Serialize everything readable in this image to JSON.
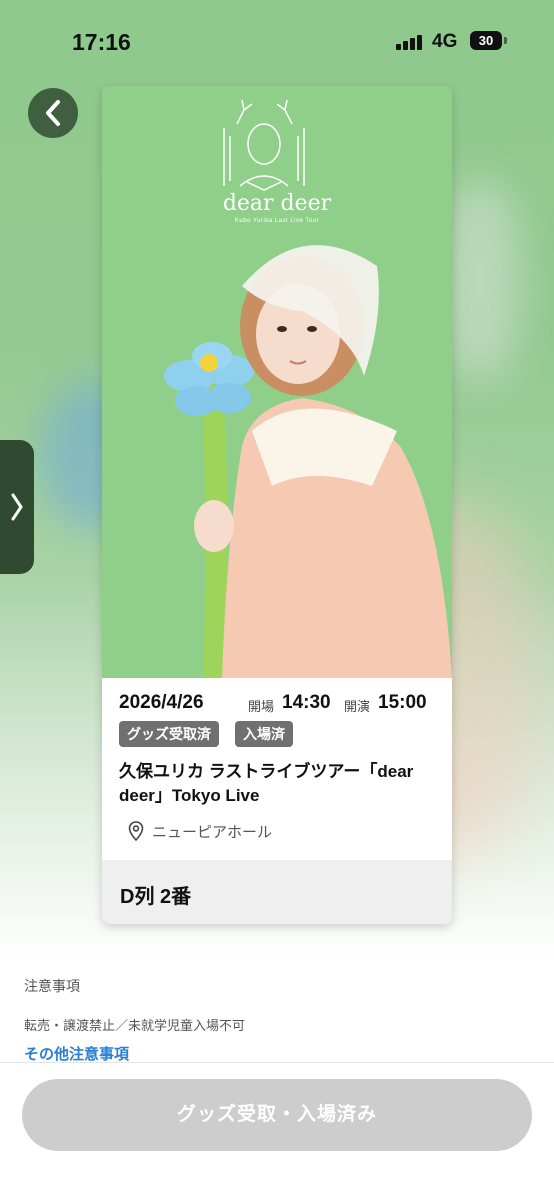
{
  "status_bar": {
    "time": "17:16",
    "network": "4G",
    "battery": "30"
  },
  "ticket": {
    "logo_title": "dear deer",
    "logo_subtitle": "Kubo Yurika Last Live Tour",
    "date": "2026/4/26",
    "open_label": "開場",
    "open_time": "14:30",
    "start_label": "開演",
    "start_time": "15:00",
    "badges": [
      "グッズ受取済",
      "入場済"
    ],
    "title": "久保ユリカ ラストライブツアー「dear deer」Tokyo Live",
    "venue": "ニューピアホール",
    "seat": "D列 2番"
  },
  "notes": {
    "heading": "注意事項",
    "text": "転売・譲渡禁止／未就学児童入場不可",
    "link": "その他注意事項"
  },
  "action_button": "グッズ受取・入場済み",
  "colors": {
    "photo_bg": "#8fcf8a",
    "badge": "#707070",
    "link": "#2a7fd4",
    "button_disabled": "#cdcdcd"
  }
}
